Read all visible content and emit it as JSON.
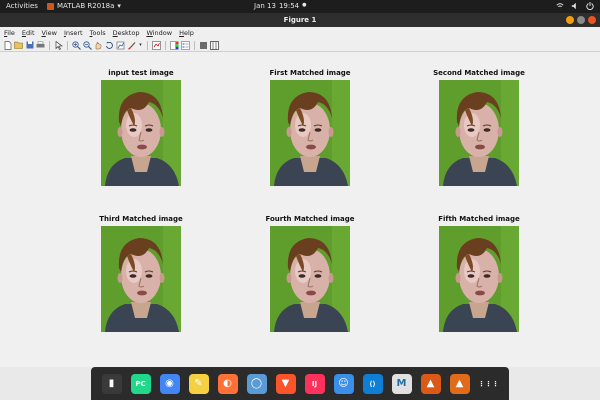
{
  "topbar": {
    "activities": "Activities",
    "app_name": "MATLAB R2018a",
    "app_menu_arrow": "▾",
    "date": "Jan 13",
    "time": "19:54",
    "status_dot": "●",
    "tray_icons": [
      "network-icon",
      "volume-icon",
      "power-icon"
    ]
  },
  "window": {
    "title": "Figure 1"
  },
  "menu": [
    "File",
    "Edit",
    "View",
    "Insert",
    "Tools",
    "Desktop",
    "Window",
    "Help"
  ],
  "toolbar_icons": [
    "new-figure-icon",
    "open-file-icon",
    "save-icon",
    "print-icon",
    "arrow-select-icon",
    "zoom-in-icon",
    "zoom-out-icon",
    "pan-icon",
    "rotate-3d-icon",
    "data-cursor-icon",
    "brush-icon",
    "link-plot-icon",
    "colorbar-icon",
    "legend-icon",
    "hide-plot-tools-icon",
    "show-plot-tools-icon"
  ],
  "panels": [
    {
      "label": "input test image"
    },
    {
      "label": "First Matched image"
    },
    {
      "label": "Second Matched image"
    },
    {
      "label": "Third Matched image"
    },
    {
      "label": "Fourth Matched image"
    },
    {
      "label": "Fifth Matched image"
    }
  ],
  "dock": [
    {
      "name": "terminal-icon",
      "color": "#3a3a3a",
      "glyph": "▮"
    },
    {
      "name": "pycharm-icon",
      "color": "#21d789",
      "glyph": "PC"
    },
    {
      "name": "chrome-icon",
      "color": "#4285f4",
      "glyph": "◉"
    },
    {
      "name": "notes-icon",
      "color": "#f5d142",
      "glyph": "✎"
    },
    {
      "name": "firefox-icon",
      "color": "#ff7139",
      "glyph": "◐"
    },
    {
      "name": "chromium-icon",
      "color": "#5b9bd5",
      "glyph": "◯"
    },
    {
      "name": "brave-icon",
      "color": "#fb542b",
      "glyph": "▼"
    },
    {
      "name": "intellij-icon",
      "color": "#fe315d",
      "glyph": "IJ"
    },
    {
      "name": "finder-icon",
      "color": "#3b8fe8",
      "glyph": "☺"
    },
    {
      "name": "vscode-icon",
      "color": "#0f7fd6",
      "glyph": "⟨⟩"
    },
    {
      "name": "mendeley-icon",
      "color": "#e0e0e0",
      "glyph": "M"
    },
    {
      "name": "matlab-icon",
      "color": "#d95a16",
      "glyph": "▲"
    },
    {
      "name": "matlab-active-icon",
      "color": "#e06b1b",
      "glyph": "▲"
    },
    {
      "name": "app-grid-icon",
      "color": "#2b2b2b",
      "glyph": "⋮⋮⋮"
    }
  ]
}
